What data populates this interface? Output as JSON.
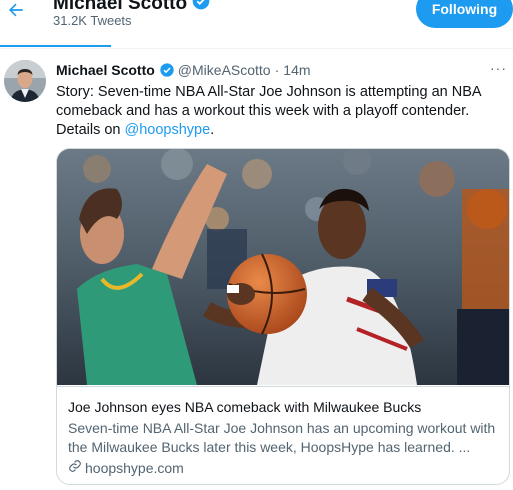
{
  "header": {
    "profile_name": "Michael Scotto",
    "tweet_count": "31.2K Tweets",
    "follow_label": "Following"
  },
  "tweet": {
    "author": "Michael Scotto",
    "handle": "@MikeAScotto",
    "separator": "·",
    "time": "14m",
    "text_main": "Story: Seven-time NBA All-Star Joe Johnson is attempting an NBA comeback and has a workout this week with a playoff contender. Details on ",
    "mention": "@hoopshype",
    "text_end": ".",
    "more_icon": "···"
  },
  "card": {
    "title": "Joe Johnson eyes NBA comeback with Milwaukee Bucks",
    "description": "Seven-time NBA All-Star Joe Johnson has an upcoming workout with the Milwaukee Bucks later this week, HoopsHype has learned. ...",
    "domain": "hoopshype.com"
  },
  "colors": {
    "accent": "#1d9bf0",
    "text_primary": "#0f1419",
    "text_secondary": "#536471",
    "border": "#cfd9de"
  },
  "icons": {
    "back": "arrow-left-icon",
    "verified": "verified-badge-icon",
    "more": "more-horizontal-icon",
    "link": "link-icon"
  }
}
